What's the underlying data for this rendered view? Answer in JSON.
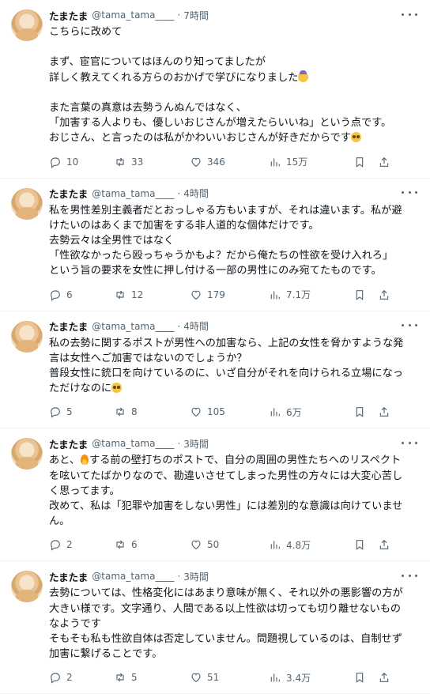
{
  "tweets": [
    {
      "name": "たまたま",
      "handle": "@tama_tama____",
      "time": "7時間",
      "lines": [
        {
          "t": "こちらに改めて"
        },
        {
          "t": ""
        },
        {
          "t": "まず、宦官についてはほんのり知ってましたが"
        },
        {
          "t": "詳しく教えてくれる方らのおかげで学びになりました",
          "emoji": "bow"
        },
        {
          "t": ""
        },
        {
          "t": "また言葉の真意は去勢うんぬんではなく、"
        },
        {
          "t": "「加害する人よりも、優しいおじさんが増えたらいいね」という点です。"
        },
        {
          "t": "おじさん、と言ったのは私がかわいいおじさんが好きだからです",
          "emoji": "plead"
        }
      ],
      "replies": "10",
      "retweets": "33",
      "likes": "346",
      "views": "15万"
    },
    {
      "name": "たまたま",
      "handle": "@tama_tama____",
      "time": "4時間",
      "lines": [
        {
          "t": "私を男性差別主義者だとおっしゃる方もいますが、それは違います。私が避"
        },
        {
          "t": "けたいのはあくまで加害をする非人道的な個体だけです。"
        },
        {
          "t": "去勢云々は全男性ではなく"
        },
        {
          "t": "「性欲なかったら殴っちゃうかもよ？だから俺たちの性欲を受け入れろ」"
        },
        {
          "t": "という旨の要求を女性に押し付ける一部の男性にのみ宛てたものです。"
        }
      ],
      "replies": "6",
      "retweets": "12",
      "likes": "179",
      "views": "7.1万"
    },
    {
      "name": "たまたま",
      "handle": "@tama_tama____",
      "time": "4時間",
      "lines": [
        {
          "t": "私の去勢に関するポストが男性への加害なら、上記の女性を脅かすような発"
        },
        {
          "t": "言は女性へご加害ではないのでしょうか？"
        },
        {
          "t": "普段女性に銃口を向けているのに、いざ自分がそれを向けられる立場になっ"
        },
        {
          "t": "ただけなのに",
          "emoji": "plead"
        }
      ],
      "replies": "5",
      "retweets": "8",
      "likes": "105",
      "views": "6万"
    },
    {
      "name": "たまたま",
      "handle": "@tama_tama____",
      "time": "3時間",
      "lines": [
        {
          "pre": "あと、",
          "emoji_mid": "fire",
          "t": "する前の壁打ちのポストで、自分の周囲の男性たちへのリスペクト"
        },
        {
          "t": "を呟いてたばかりなので、勘違いさせてしまった男性の方々には大変心苦し"
        },
        {
          "t": "く思ってます。"
        },
        {
          "t": "改めて、私は「犯罪や加害をしない男性」には差別的な意識は向けていませ"
        },
        {
          "t": "ん。"
        }
      ],
      "replies": "2",
      "retweets": "6",
      "likes": "50",
      "views": "4.8万"
    },
    {
      "name": "たまたま",
      "handle": "@tama_tama____",
      "time": "3時間",
      "lines": [
        {
          "t": "去勢については、性格変化にはあまり意味が無く、それ以外の悪影響の方が"
        },
        {
          "t": "大きい様です。文字通り、人間である以上性欲は切っても切り離せないもの"
        },
        {
          "t": "なようです"
        },
        {
          "t": "そもそも私も性欲自体は否定していません。問題視しているのは、自制せず"
        },
        {
          "t": "加害に繋げることです。"
        }
      ],
      "replies": "2",
      "retweets": "5",
      "likes": "51",
      "views": "3.4万"
    }
  ],
  "icons": {
    "more": "more-dots-icon",
    "reply": "reply-icon",
    "retweet": "retweet-icon",
    "like": "heart-icon",
    "views": "views-chart-icon",
    "bookmark": "bookmark-icon",
    "share": "share-icon"
  },
  "colors": {
    "text": "#0f1419",
    "secondary": "#536471",
    "divider": "#eff3f4"
  }
}
